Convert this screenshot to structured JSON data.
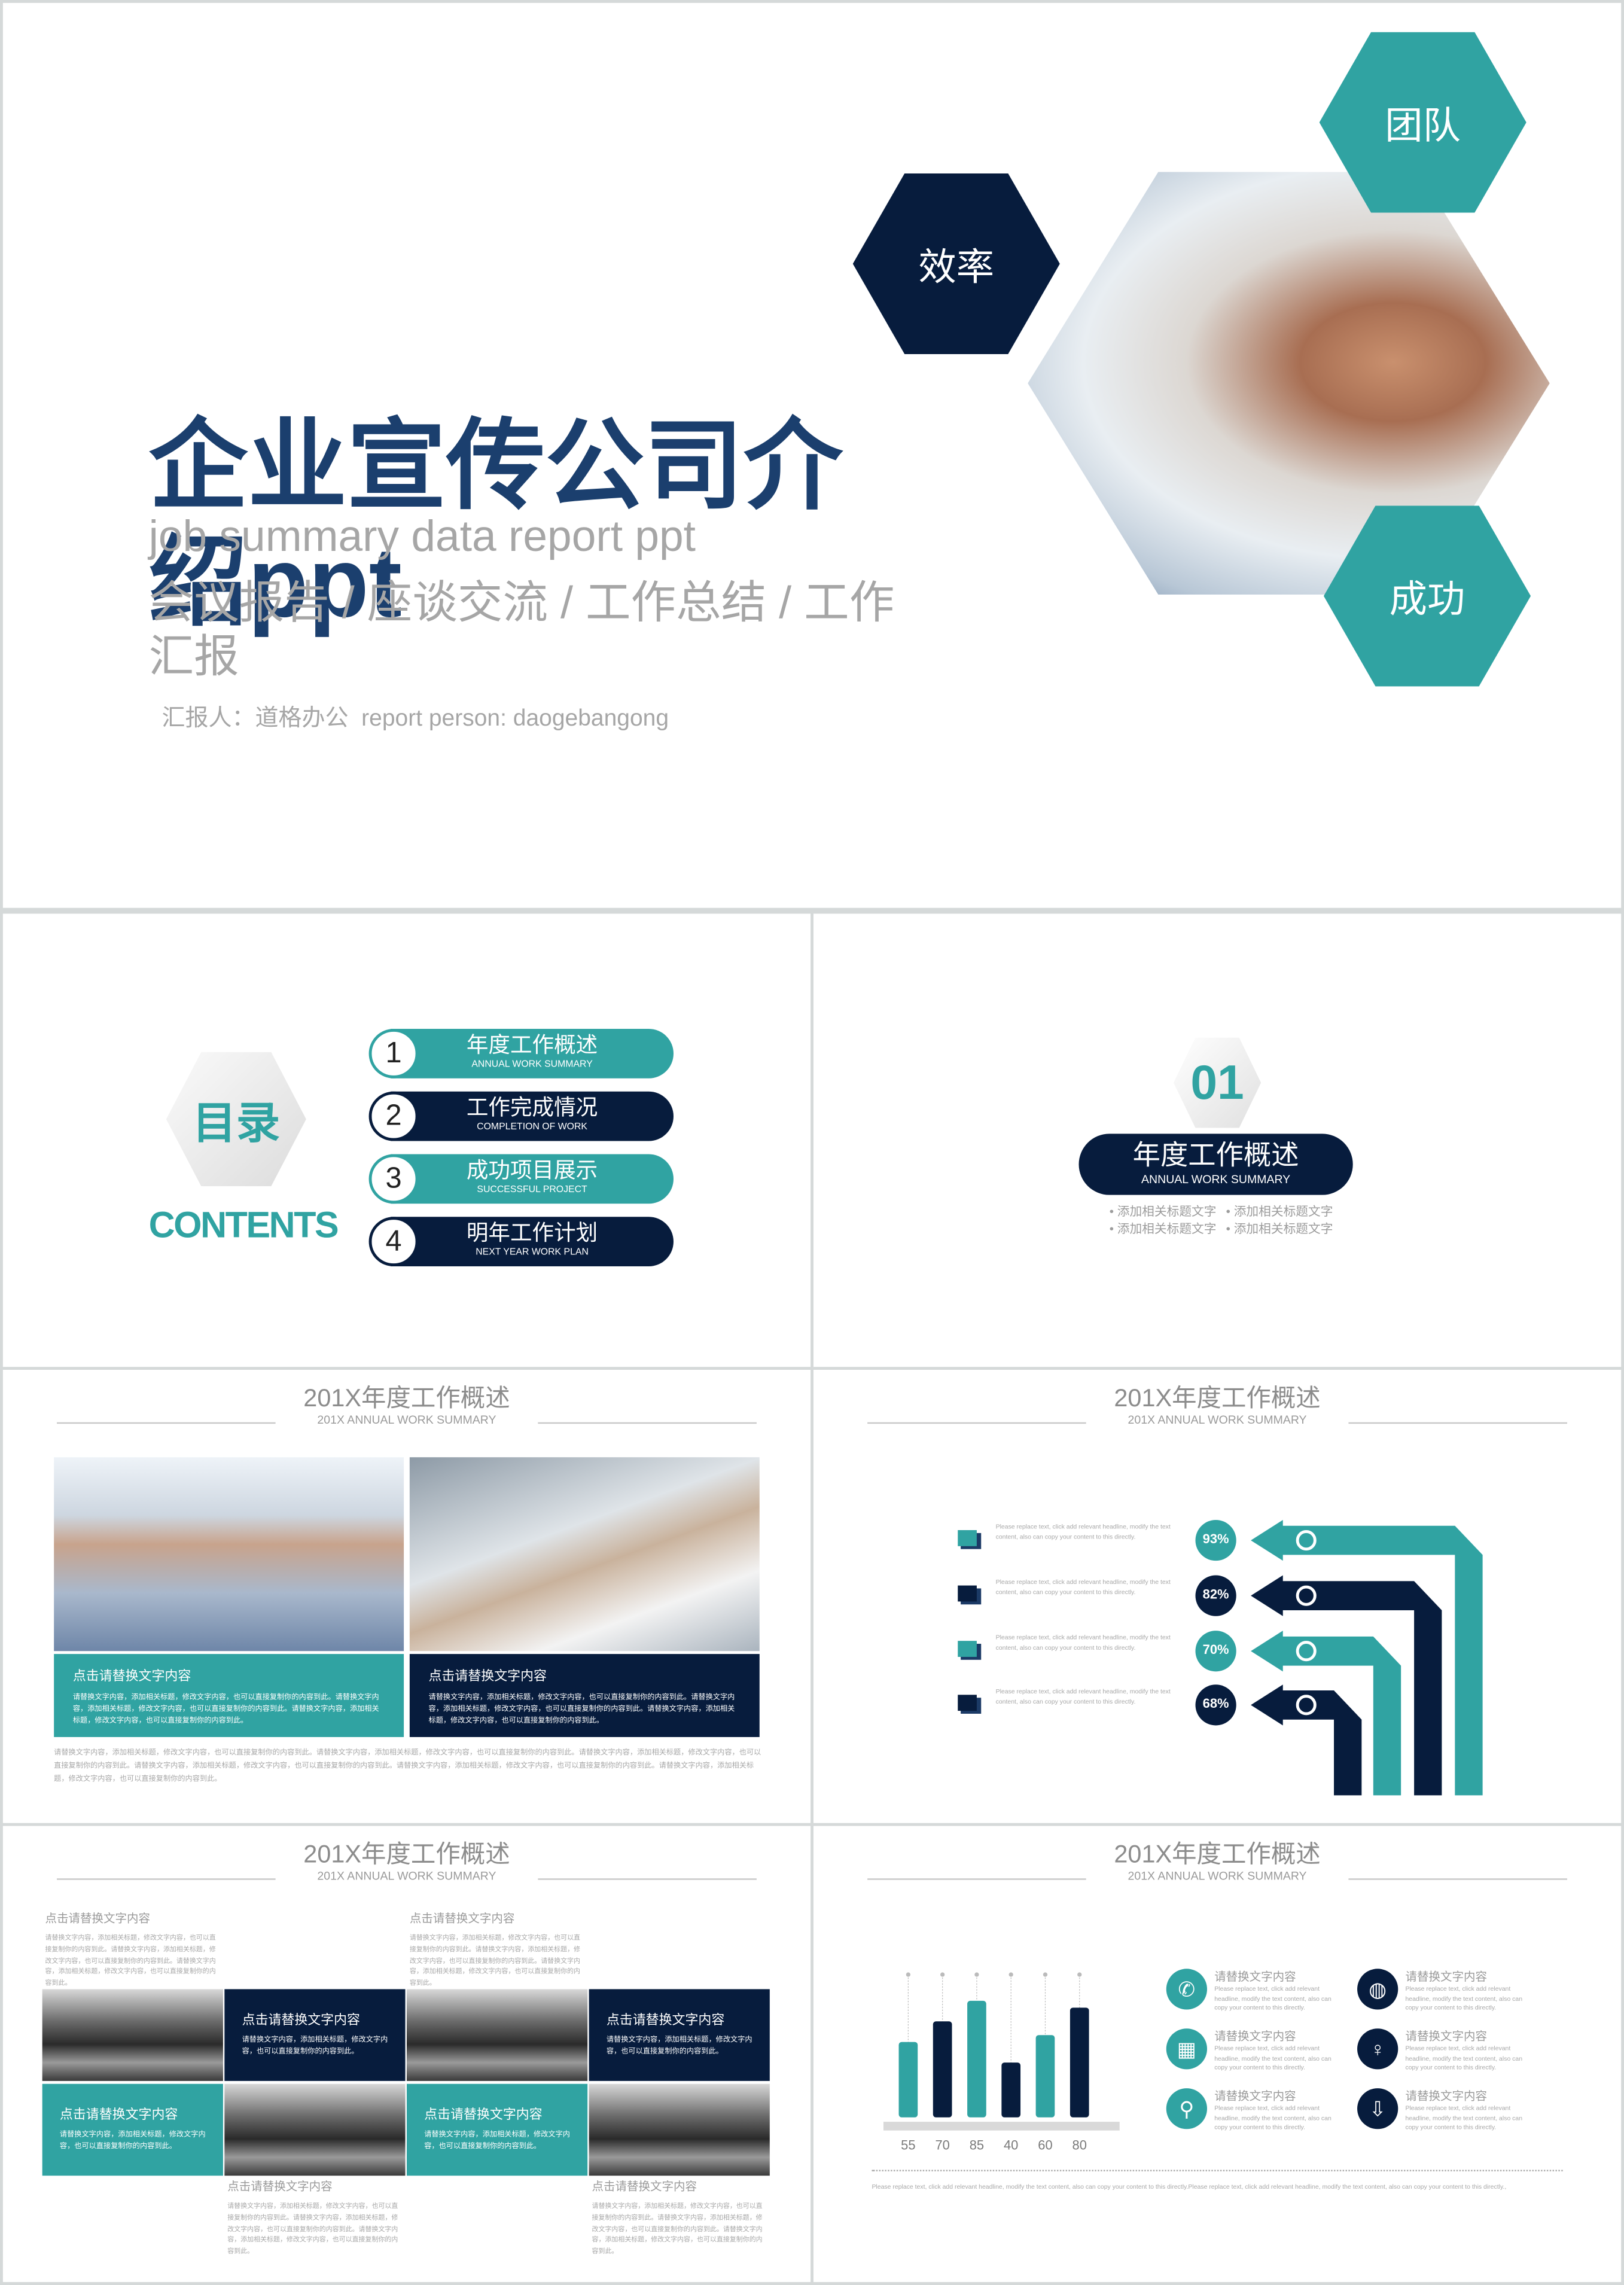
{
  "colors": {
    "teal": "#30a3a2",
    "navy": "#071c3d",
    "title_blue": "#1b3f6e",
    "gray_text": "#9c9c9c"
  },
  "cover": {
    "title": "企业宣传公司介绍ppt",
    "subtitle_en": "job summary data report ppt",
    "subtitle_cn": "会议报告 / 座谈交流 / 工作总结 / 工作汇报",
    "reporter": "汇报人：道格办公  report person: daogebangong",
    "hexagons": [
      {
        "label": "效率",
        "color": "navy"
      },
      {
        "label": "团队",
        "color": "teal"
      },
      {
        "label": "成功",
        "color": "teal"
      }
    ],
    "photo": "handshake-photo"
  },
  "contents": {
    "title_cn": "目录",
    "title_en": "CONTENTS",
    "items": [
      {
        "num": "1",
        "cn": "年度工作概述",
        "en": "ANNUAL WORK SUMMARY",
        "color": "teal"
      },
      {
        "num": "2",
        "cn": "工作完成情况",
        "en": "COMPLETION OF WORK",
        "color": "navy"
      },
      {
        "num": "3",
        "cn": "成功项目展示",
        "en": "SUCCESSFUL PROJECT",
        "color": "teal"
      },
      {
        "num": "4",
        "cn": "明年工作计划",
        "en": "NEXT YEAR WORK PLAN",
        "color": "navy"
      }
    ]
  },
  "section": {
    "num": "01",
    "cn": "年度工作概述",
    "en": "ANNUAL WORK SUMMARY",
    "bullets": [
      "添加相关标题文字",
      "添加相关标题文字",
      "添加相关标题文字",
      "添加相关标题文字"
    ]
  },
  "slide_header": {
    "title": "201X年度工作概述",
    "subtitle": "201X ANNUAL WORK SUMMARY"
  },
  "photo_slide": {
    "boxes": [
      {
        "title": "点击请替换文字内容",
        "body": "请替换文字内容，添加相关标题，修改文字内容，也可以直接复制你的内容到此。请替换文字内容，添加相关标题，修改文字内容，也可以直接复制你的内容到此。请替换文字内容，添加相关标题，修改文字内容，也可以直接复制你的内容到此。",
        "color": "teal"
      },
      {
        "title": "点击请替换文字内容",
        "body": "请替换文字内容，添加相关标题，修改文字内容，也可以直接复制你的内容到此。请替换文字内容，添加相关标题，修改文字内容，也可以直接复制你的内容到此。请替换文字内容，添加相关标题，修改文字内容，也可以直接复制你的内容到此。",
        "color": "navy"
      }
    ],
    "footer": "请替换文字内容，添加相关标题，修改文字内容，也可以直接复制你的内容到此。请替换文字内容，添加相关标题，修改文字内容，也可以直接复制你的内容到此。请替换文字内容，添加相关标题，修改文字内容，也可以直接复制你的内容到此。请替换文字内容，添加相关标题，修改文字内容，也可以直接复制你的内容到此。请替换文字内容，添加相关标题，修改文字内容，也可以直接复制你的内容到此。请替换文字内容，添加相关标题，修改文字内容，也可以直接复制你的内容到此。"
  },
  "arrows_slide": {
    "items": [
      {
        "percent": "93%",
        "value": 93,
        "text": "Please replace text, click add relevant headline, modify the text content, also can copy your content to this directly.",
        "icon": "power-icon",
        "color": "teal"
      },
      {
        "percent": "82%",
        "value": 82,
        "text": "Please replace text, click add relevant headline, modify the text content, also can copy your content to this directly.",
        "icon": "megaphone-icon",
        "color": "navy"
      },
      {
        "percent": "70%",
        "value": 70,
        "text": "Please replace text, click add relevant headline, modify the text content, also can copy your content to this directly.",
        "icon": "umbrella-icon",
        "color": "teal"
      },
      {
        "percent": "68%",
        "value": 68,
        "text": "Please replace text, click add relevant headline, modify the text content, also can copy your content to this directly.",
        "icon": "camera-icon",
        "color": "navy"
      }
    ]
  },
  "grid_slide": {
    "title": "点击请替换文字内容",
    "long_body": "请替换文字内容，添加相关标题，修改文字内容，也可以直接复制你的内容到此。请替换文字内容，添加相关标题，修改文字内容，也可以直接复制你的内容到此。请替换文字内容，添加相关标题，修改文字内容，也可以直接复制你的内容到此。",
    "short_body": "请替换文字内容，添加相关标题，修改文字内容，也可以直接复制你的内容到此。"
  },
  "chart_slide": {
    "features": [
      {
        "title": "请替换文字内容",
        "text": "Please replace text, click add relevant headline, modify the text content, also can copy your content to this directly.",
        "icon": "phone-icon",
        "glyph": "✆",
        "color": "teal"
      },
      {
        "title": "请替换文字内容",
        "text": "Please replace text, click add relevant headline, modify the text content, also can copy your content to this directly.",
        "icon": "globe-icon",
        "glyph": "◍",
        "color": "navy"
      },
      {
        "title": "请替换文字内容",
        "text": "Please replace text, click add relevant headline, modify the text content, also can copy your content to this directly.",
        "icon": "calendar-icon",
        "glyph": "▦",
        "color": "teal"
      },
      {
        "title": "请替换文字内容",
        "text": "Please replace text, click add relevant headline, modify the text content, also can copy your content to this directly.",
        "icon": "lightbulb-icon",
        "glyph": "♀",
        "color": "navy"
      },
      {
        "title": "请替换文字内容",
        "text": "Please replace text, click add relevant headline, modify the text content, also can copy your content to this directly.",
        "icon": "location-pin-icon",
        "glyph": "⚲",
        "color": "teal"
      },
      {
        "title": "请替换文字内容",
        "text": "Please replace text, click add relevant headline, modify the text content, also can copy your content to this directly.",
        "icon": "cloud-download-icon",
        "glyph": "⇩",
        "color": "navy"
      }
    ],
    "footer": "Please replace text, click add relevant headline, modify the text content, also can copy your content to this directly.Please replace text, click add relevant headline, modify the text content, also can copy your content to this directly.,"
  },
  "chart_data": {
    "type": "bar",
    "categories": [
      "55",
      "70",
      "85",
      "40",
      "60",
      "80"
    ],
    "values": [
      55,
      70,
      85,
      40,
      60,
      80
    ],
    "colors": [
      "teal",
      "navy",
      "teal",
      "navy",
      "teal",
      "navy"
    ],
    "ylim": [
      0,
      85
    ],
    "grid": false
  }
}
